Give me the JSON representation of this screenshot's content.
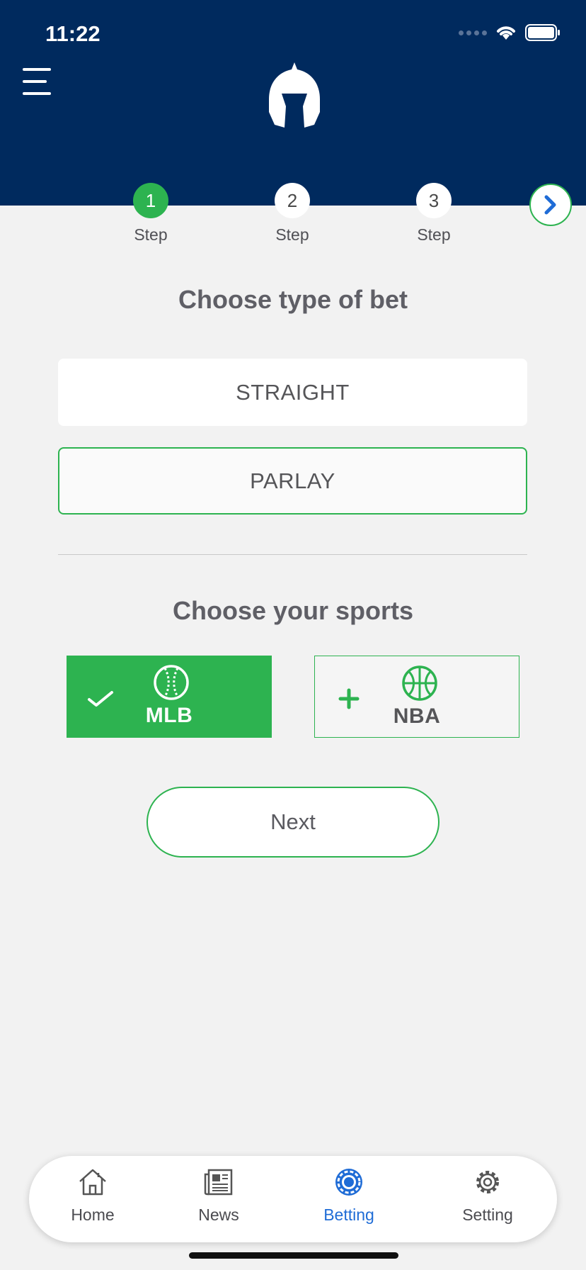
{
  "status_bar": {
    "time": "11:22"
  },
  "header": {
    "menu_icon": "hamburger-menu-icon",
    "logo_icon": "spartan-helmet-icon"
  },
  "steps": [
    {
      "number": "1",
      "label": "Step",
      "active": true
    },
    {
      "number": "2",
      "label": "Step",
      "active": false
    },
    {
      "number": "3",
      "label": "Step",
      "active": false
    }
  ],
  "bet_type": {
    "title": "Choose type of bet",
    "options": [
      {
        "label": "STRAIGHT",
        "selected": false
      },
      {
        "label": "PARLAY",
        "selected": true
      }
    ]
  },
  "sports": {
    "title": "Choose your sports",
    "items": [
      {
        "label": "MLB",
        "selected": true,
        "icon": "baseball-icon"
      },
      {
        "label": "NBA",
        "selected": false,
        "icon": "basketball-icon"
      }
    ]
  },
  "next_button": {
    "label": "Next"
  },
  "tab_bar": {
    "items": [
      {
        "label": "Home",
        "icon": "home-icon",
        "active": false
      },
      {
        "label": "News",
        "icon": "newspaper-icon",
        "active": false
      },
      {
        "label": "Betting",
        "icon": "poker-chip-icon",
        "active": true
      },
      {
        "label": "Setting",
        "icon": "gear-icon",
        "active": false
      }
    ]
  },
  "colors": {
    "header": "#002a5e",
    "accent": "#2db350",
    "active_tab": "#1f6cd6",
    "background": "#f2f2f2"
  }
}
